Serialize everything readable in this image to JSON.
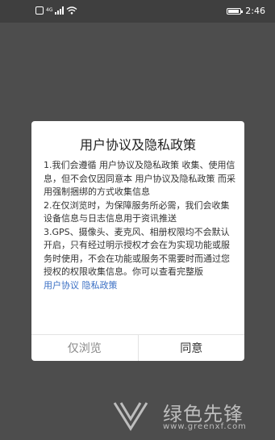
{
  "status_bar": {
    "network": "4G",
    "time": "2:46",
    "battery_level": 0.9
  },
  "dialog": {
    "title": "用户协议及隐私政策",
    "paragraphs": [
      "1.我们会遵循 用户协议及隐私政策 收集、使用信息，但不会仅因同意本 用户协议及隐私政策 而采用强制捆绑的方式收集信息",
      "2.在仅浏览时，为保障服务所必需，我们会收集设备信息与日志信息用于资讯推送",
      "3.GPS、摄像头、麦克风、相册权限均不会默认开启，只有经过明示授权才会在为实现功能或服务时使用，不会在功能或服务不需要时而通过您授权的权限收集信息。你可以查看完整版"
    ],
    "links": {
      "user_agreement": "用户协议",
      "privacy_policy": "隐私政策"
    },
    "buttons": {
      "browse_only": "仅浏览",
      "agree": "同意"
    }
  },
  "watermark": {
    "brand": "绿色先锋",
    "url": "www.greenxf.com"
  },
  "colors": {
    "overlay_background": "#4d4d4d",
    "dialog_background": "#ffffff",
    "link": "#3a6fc4",
    "secondary_button": "#888888"
  }
}
